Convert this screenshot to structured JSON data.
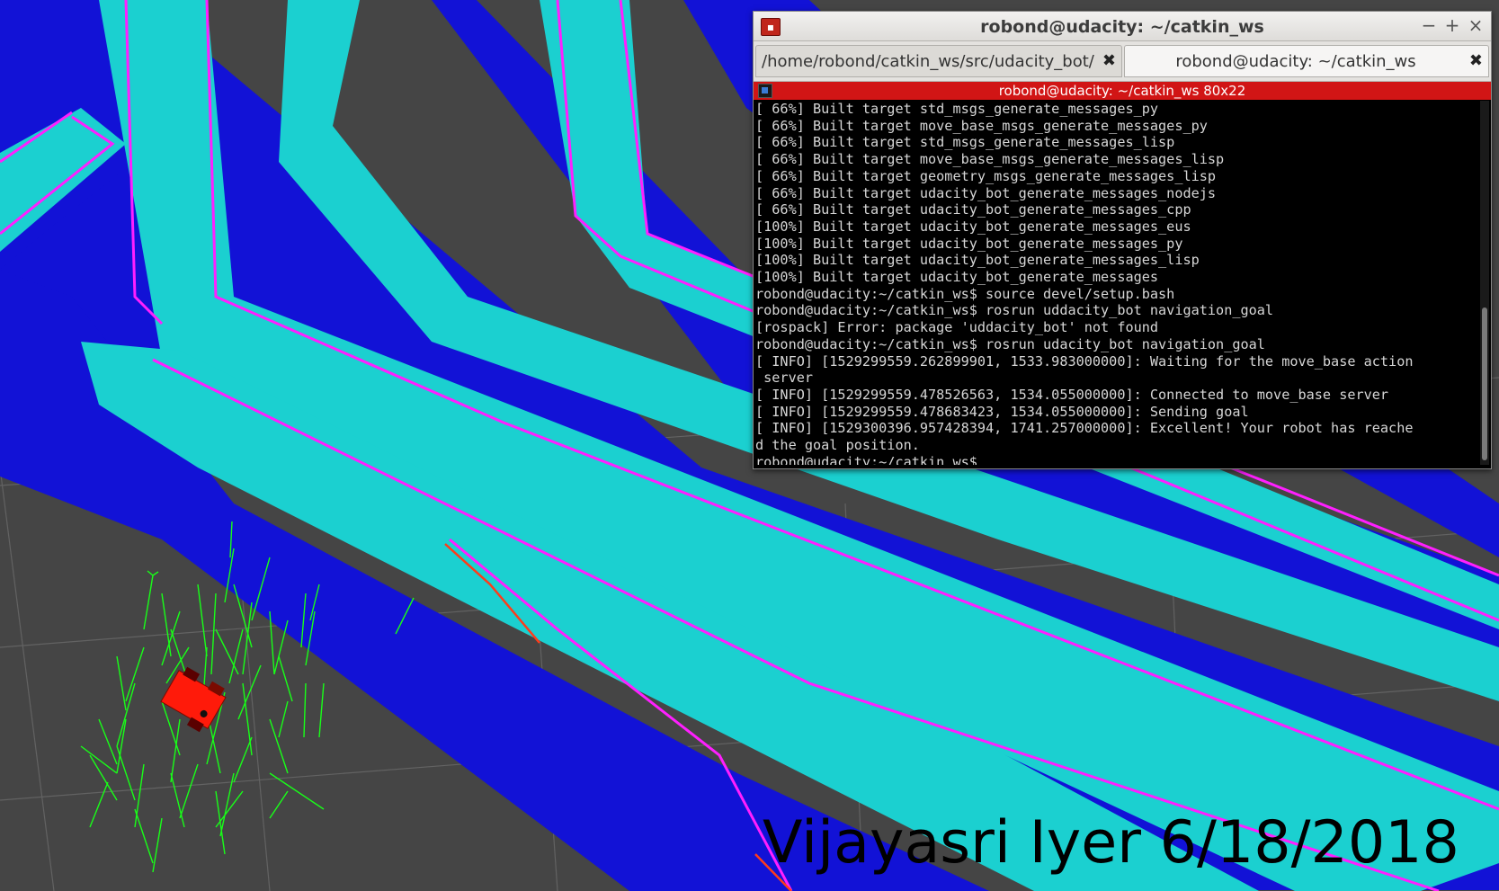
{
  "terminal": {
    "window_title": "robond@udacity: ~/catkin_ws",
    "tabs": [
      {
        "label": "/home/robond/catkin_ws/src/udacity_bot/l"
      },
      {
        "label": "robond@udacity: ~/catkin_ws"
      }
    ],
    "session_title": "robond@udacity: ~/catkin_ws 80x22",
    "lines": [
      "[ 66%] Built target std_msgs_generate_messages_py",
      "[ 66%] Built target move_base_msgs_generate_messages_py",
      "[ 66%] Built target std_msgs_generate_messages_lisp",
      "[ 66%] Built target move_base_msgs_generate_messages_lisp",
      "[ 66%] Built target geometry_msgs_generate_messages_lisp",
      "[ 66%] Built target udacity_bot_generate_messages_nodejs",
      "[ 66%] Built target udacity_bot_generate_messages_cpp",
      "[100%] Built target udacity_bot_generate_messages_eus",
      "[100%] Built target udacity_bot_generate_messages_py",
      "[100%] Built target udacity_bot_generate_messages_lisp",
      "[100%] Built target udacity_bot_generate_messages",
      "robond@udacity:~/catkin_ws$ source devel/setup.bash",
      "robond@udacity:~/catkin_ws$ rosrun uddacity_bot navigation_goal",
      "[rospack] Error: package 'uddacity_bot' not found",
      "robond@udacity:~/catkin_ws$ rosrun udacity_bot navigation_goal",
      "[ INFO] [1529299559.262899901, 1533.983000000]: Waiting for the move_base action",
      " server",
      "[ INFO] [1529299559.478526563, 1534.055000000]: Connected to move_base server",
      "[ INFO] [1529299559.478683423, 1534.055000000]: Sending goal",
      "[ INFO] [1529300396.957428394, 1741.257000000]: Excellent! Your robot has reache",
      "d the goal position.",
      "robond@udacity:~/catkin_ws$ "
    ]
  },
  "overlay_text": "Vijayasri Iyer  6/18/2018",
  "colors": {
    "background": "#454545",
    "costmap_free": "#1cd2d2",
    "costmap_inflation": "#1010d8",
    "costmap_edge": "#8a1040",
    "obstacle": "#ff22ff",
    "particles": "#00ff00",
    "robot": "#ff1a0a"
  },
  "icons": {
    "terminal_app": "terminal-app-icon",
    "minimize": "minimize-icon",
    "maximize": "maximize-icon",
    "close": "close-icon"
  },
  "window_controls": {
    "minimize": "−",
    "maximize": "+",
    "close": "×",
    "tab_close": "✖",
    "app_icon": "▪"
  }
}
